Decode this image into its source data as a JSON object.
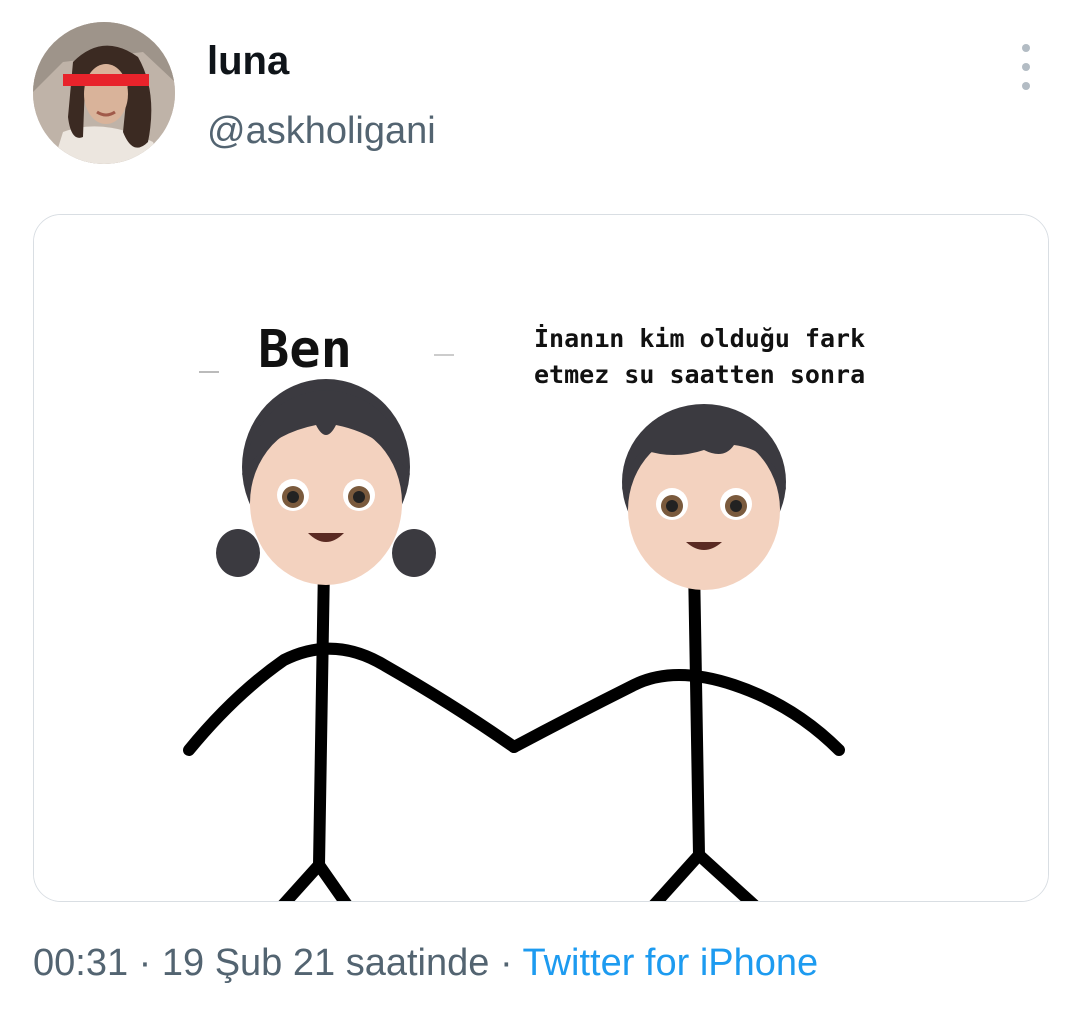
{
  "tweet": {
    "display_name": "luna",
    "handle": "@askholigani",
    "more_icon": "more-vertical-icon",
    "time": "00:31",
    "date": "19 Şub 21 saatinde",
    "separator": "·",
    "source": "Twitter for iPhone"
  },
  "media": {
    "label_left": "Ben",
    "caption_line1": "İnanın kim olduğu fark",
    "caption_line2": "etmez su saatten sonra"
  },
  "colors": {
    "text_primary": "#0f1419",
    "text_secondary": "#536471",
    "link": "#1d9bf0",
    "censor_bar": "#e8232b"
  }
}
